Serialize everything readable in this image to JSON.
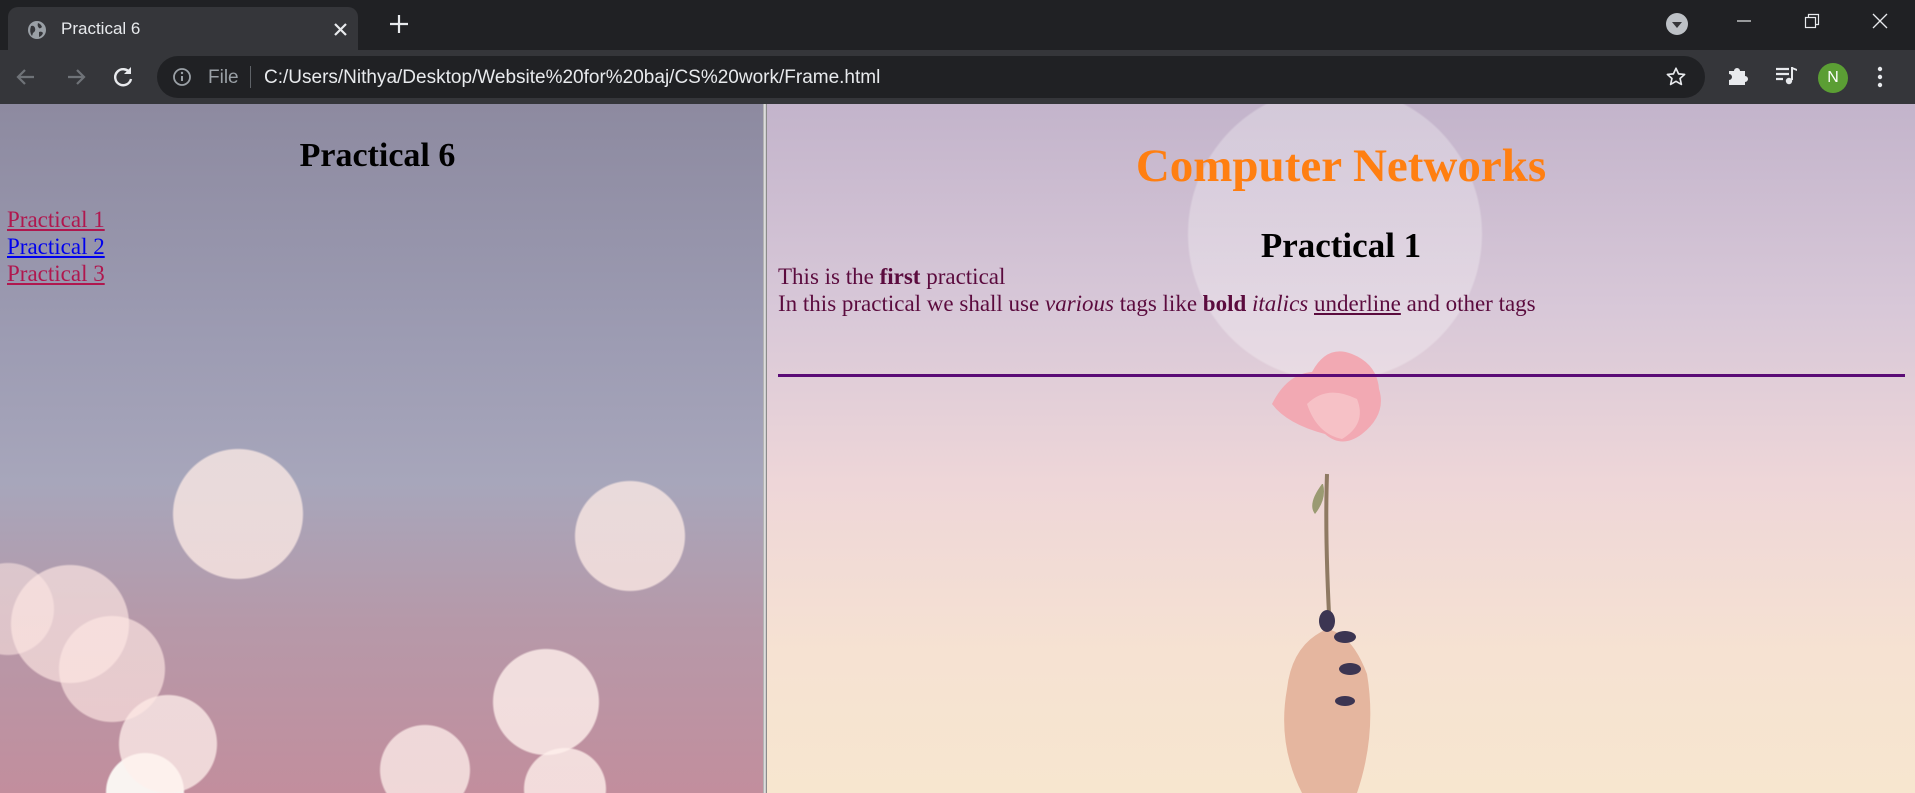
{
  "browser": {
    "tab": {
      "title": "Practical 6"
    },
    "omnibox": {
      "scheme_label": "File",
      "url": "C:/Users/Nithya/Desktop/Website%20for%20baj/CS%20work/Frame.html"
    },
    "profile_initial": "N",
    "icons": [
      "globe-icon",
      "close-icon",
      "plus-icon",
      "profile-dropdown-icon",
      "minimize-icon",
      "restore-icon",
      "window-close-icon",
      "back-icon",
      "forward-icon",
      "reload-icon",
      "info-icon",
      "star-icon",
      "extensions-icon",
      "media-icon",
      "kebab-menu-icon"
    ]
  },
  "left_frame": {
    "title": "Practical 6",
    "links": [
      {
        "label": "Practical 1",
        "color": "#b0174e"
      },
      {
        "label": "Practical 2",
        "color": "#0000ee"
      },
      {
        "label": "Practical 3",
        "color": "#b0174e"
      }
    ]
  },
  "right_frame": {
    "title": "Computer Networks",
    "title_color": "#ff7f11",
    "subtitle": "Practical 1",
    "text_color": "#5b0b3e",
    "hr_color": "#5b0b76",
    "line1": {
      "t1": "This is the ",
      "b1": "first",
      "t2": " practical"
    },
    "line2": {
      "t1": "In this practical we shall use ",
      "i1": "various",
      "t2": " tags like ",
      "b1": "bold",
      "t3": " ",
      "i2": "italics",
      "t4": " ",
      "u1": "underline",
      "t5": " and other tags"
    }
  }
}
